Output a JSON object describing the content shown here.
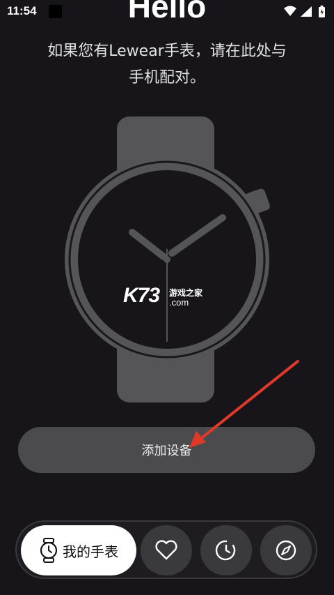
{
  "status_bar": {
    "time": "11:54"
  },
  "header": {
    "title": "Hello",
    "subtitle_line1": "如果您有Lewear手表，请在此处与",
    "subtitle_line2": "手机配对。"
  },
  "watermark": {
    "brand": "K73",
    "site": "游戏之家",
    "domain": ".com"
  },
  "main": {
    "add_device_label": "添加设备"
  },
  "bottom_nav": {
    "tabs": [
      {
        "label": "我的手表",
        "icon": "watch-icon",
        "active": true
      },
      {
        "label": "",
        "icon": "heart-icon",
        "active": false
      },
      {
        "label": "",
        "icon": "clock-icon",
        "active": false
      },
      {
        "label": "",
        "icon": "compass-icon",
        "active": false
      }
    ]
  },
  "colors": {
    "background": "#17151a",
    "button": "#4b4a4d",
    "watch": "#555457",
    "arrow": "#e0392a"
  }
}
